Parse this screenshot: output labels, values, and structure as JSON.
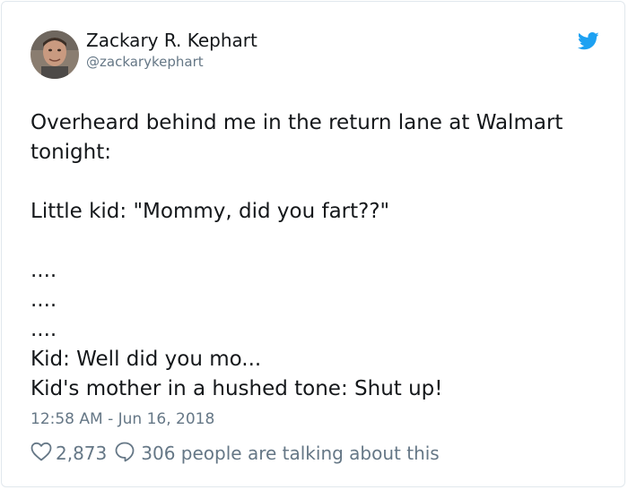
{
  "author": {
    "name": "Zackary R. Kephart",
    "handle": "@zackarykephart"
  },
  "tweet": {
    "lines": [
      "Overheard behind me in the return lane at Walmart",
      "tonight:",
      "",
      "Little kid: \"Mommy, did you fart??\"",
      "",
      "....",
      "....",
      "....",
      "Kid: Well did you mo...",
      "Kid's mother in a hushed tone: Shut up!"
    ],
    "timestamp": "12:58 AM - Jun 16, 2018"
  },
  "footer": {
    "likes": "2,873",
    "replies_text": "306 people are talking about this"
  },
  "icons": {
    "bird": "twitter-bird-icon",
    "heart": "heart-icon",
    "reply": "speech-bubble-icon"
  },
  "colors": {
    "twitter_blue": "#1da1f2",
    "secondary_text": "#657786",
    "primary_text": "#14171a"
  }
}
